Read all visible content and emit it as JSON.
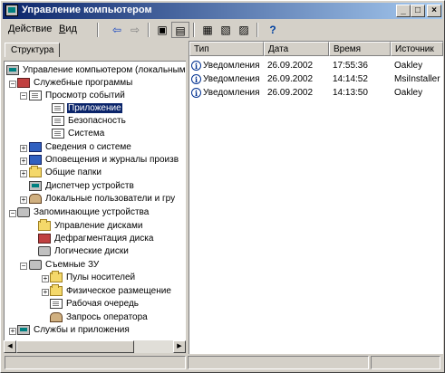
{
  "window": {
    "title": "Управление компьютером",
    "controls": {
      "minimize": "_",
      "maximize": "□",
      "close": "×"
    }
  },
  "menu": {
    "items": [
      {
        "underline": "Д",
        "rest": "ействие"
      },
      {
        "underline": "В",
        "rest": "ид"
      }
    ]
  },
  "toolbar": {
    "back": "⇦",
    "forward": "⇨",
    "up": "▣",
    "show_hide_tree": "▤",
    "properties": "▦",
    "export": "▧",
    "refresh": "▨",
    "help": "?"
  },
  "tabs": {
    "structure": "Структура"
  },
  "tree": [
    {
      "label": "Управление компьютером (локальным",
      "icon": "pc"
    },
    {
      "label": "Служебные программы",
      "icon": "tools"
    },
    {
      "label": "Просмотр событий",
      "icon": "events"
    },
    {
      "label": "Приложение",
      "icon": "log",
      "selected": true
    },
    {
      "label": "Безопасность",
      "icon": "log"
    },
    {
      "label": "Система",
      "icon": "log"
    },
    {
      "label": "Сведения о системе",
      "icon": "info"
    },
    {
      "label": "Оповещения и журналы произв",
      "icon": "alerts"
    },
    {
      "label": "Общие папки",
      "icon": "folder"
    },
    {
      "label": "Диспетчер устройств",
      "icon": "devices"
    },
    {
      "label": "Локальные пользователи и гру",
      "icon": "users"
    },
    {
      "label": "Запоминающие устройства",
      "icon": "storage"
    },
    {
      "label": "Управление дисками",
      "icon": "folder"
    },
    {
      "label": "Дефрагментация диска",
      "icon": "defrag"
    },
    {
      "label": "Логические диски",
      "icon": "disk"
    },
    {
      "label": "Съемные ЗУ",
      "icon": "removable"
    },
    {
      "label": "Пулы носителей",
      "icon": "folder"
    },
    {
      "label": "Физическое размещение",
      "icon": "folder"
    },
    {
      "label": "Рабочая очередь",
      "icon": "queue"
    },
    {
      "label": "Запрось оператора",
      "icon": "operator"
    },
    {
      "label": "Службы и приложения",
      "icon": "services"
    }
  ],
  "table": {
    "columns": [
      "Тип",
      "Дата",
      "Время",
      "Источник"
    ],
    "rows": [
      {
        "type": "Уведомления",
        "date": "26.09.2002",
        "time": "17:55:36",
        "source": "Oakley"
      },
      {
        "type": "Уведомления",
        "date": "26.09.2002",
        "time": "14:14:52",
        "source": "MsiInstaller"
      },
      {
        "type": "Уведомления",
        "date": "26.09.2002",
        "time": "14:13:50",
        "source": "Oakley"
      }
    ]
  },
  "scrollbar": {
    "left_arrow": "◀",
    "right_arrow": "▶"
  }
}
